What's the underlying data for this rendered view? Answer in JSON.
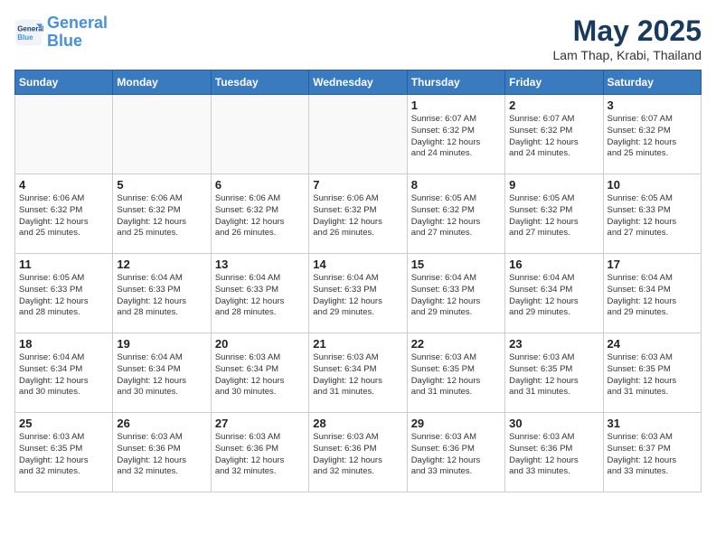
{
  "header": {
    "logo_line1": "General",
    "logo_line2": "Blue",
    "month_title": "May 2025",
    "location": "Lam Thap, Krabi, Thailand"
  },
  "weekdays": [
    "Sunday",
    "Monday",
    "Tuesday",
    "Wednesday",
    "Thursday",
    "Friday",
    "Saturday"
  ],
  "weeks": [
    [
      {
        "day": "",
        "info": ""
      },
      {
        "day": "",
        "info": ""
      },
      {
        "day": "",
        "info": ""
      },
      {
        "day": "",
        "info": ""
      },
      {
        "day": "1",
        "info": "Sunrise: 6:07 AM\nSunset: 6:32 PM\nDaylight: 12 hours\nand 24 minutes."
      },
      {
        "day": "2",
        "info": "Sunrise: 6:07 AM\nSunset: 6:32 PM\nDaylight: 12 hours\nand 24 minutes."
      },
      {
        "day": "3",
        "info": "Sunrise: 6:07 AM\nSunset: 6:32 PM\nDaylight: 12 hours\nand 25 minutes."
      }
    ],
    [
      {
        "day": "4",
        "info": "Sunrise: 6:06 AM\nSunset: 6:32 PM\nDaylight: 12 hours\nand 25 minutes."
      },
      {
        "day": "5",
        "info": "Sunrise: 6:06 AM\nSunset: 6:32 PM\nDaylight: 12 hours\nand 25 minutes."
      },
      {
        "day": "6",
        "info": "Sunrise: 6:06 AM\nSunset: 6:32 PM\nDaylight: 12 hours\nand 26 minutes."
      },
      {
        "day": "7",
        "info": "Sunrise: 6:06 AM\nSunset: 6:32 PM\nDaylight: 12 hours\nand 26 minutes."
      },
      {
        "day": "8",
        "info": "Sunrise: 6:05 AM\nSunset: 6:32 PM\nDaylight: 12 hours\nand 27 minutes."
      },
      {
        "day": "9",
        "info": "Sunrise: 6:05 AM\nSunset: 6:32 PM\nDaylight: 12 hours\nand 27 minutes."
      },
      {
        "day": "10",
        "info": "Sunrise: 6:05 AM\nSunset: 6:33 PM\nDaylight: 12 hours\nand 27 minutes."
      }
    ],
    [
      {
        "day": "11",
        "info": "Sunrise: 6:05 AM\nSunset: 6:33 PM\nDaylight: 12 hours\nand 28 minutes."
      },
      {
        "day": "12",
        "info": "Sunrise: 6:04 AM\nSunset: 6:33 PM\nDaylight: 12 hours\nand 28 minutes."
      },
      {
        "day": "13",
        "info": "Sunrise: 6:04 AM\nSunset: 6:33 PM\nDaylight: 12 hours\nand 28 minutes."
      },
      {
        "day": "14",
        "info": "Sunrise: 6:04 AM\nSunset: 6:33 PM\nDaylight: 12 hours\nand 29 minutes."
      },
      {
        "day": "15",
        "info": "Sunrise: 6:04 AM\nSunset: 6:33 PM\nDaylight: 12 hours\nand 29 minutes."
      },
      {
        "day": "16",
        "info": "Sunrise: 6:04 AM\nSunset: 6:34 PM\nDaylight: 12 hours\nand 29 minutes."
      },
      {
        "day": "17",
        "info": "Sunrise: 6:04 AM\nSunset: 6:34 PM\nDaylight: 12 hours\nand 29 minutes."
      }
    ],
    [
      {
        "day": "18",
        "info": "Sunrise: 6:04 AM\nSunset: 6:34 PM\nDaylight: 12 hours\nand 30 minutes."
      },
      {
        "day": "19",
        "info": "Sunrise: 6:04 AM\nSunset: 6:34 PM\nDaylight: 12 hours\nand 30 minutes."
      },
      {
        "day": "20",
        "info": "Sunrise: 6:03 AM\nSunset: 6:34 PM\nDaylight: 12 hours\nand 30 minutes."
      },
      {
        "day": "21",
        "info": "Sunrise: 6:03 AM\nSunset: 6:34 PM\nDaylight: 12 hours\nand 31 minutes."
      },
      {
        "day": "22",
        "info": "Sunrise: 6:03 AM\nSunset: 6:35 PM\nDaylight: 12 hours\nand 31 minutes."
      },
      {
        "day": "23",
        "info": "Sunrise: 6:03 AM\nSunset: 6:35 PM\nDaylight: 12 hours\nand 31 minutes."
      },
      {
        "day": "24",
        "info": "Sunrise: 6:03 AM\nSunset: 6:35 PM\nDaylight: 12 hours\nand 31 minutes."
      }
    ],
    [
      {
        "day": "25",
        "info": "Sunrise: 6:03 AM\nSunset: 6:35 PM\nDaylight: 12 hours\nand 32 minutes."
      },
      {
        "day": "26",
        "info": "Sunrise: 6:03 AM\nSunset: 6:36 PM\nDaylight: 12 hours\nand 32 minutes."
      },
      {
        "day": "27",
        "info": "Sunrise: 6:03 AM\nSunset: 6:36 PM\nDaylight: 12 hours\nand 32 minutes."
      },
      {
        "day": "28",
        "info": "Sunrise: 6:03 AM\nSunset: 6:36 PM\nDaylight: 12 hours\nand 32 minutes."
      },
      {
        "day": "29",
        "info": "Sunrise: 6:03 AM\nSunset: 6:36 PM\nDaylight: 12 hours\nand 33 minutes."
      },
      {
        "day": "30",
        "info": "Sunrise: 6:03 AM\nSunset: 6:36 PM\nDaylight: 12 hours\nand 33 minutes."
      },
      {
        "day": "31",
        "info": "Sunrise: 6:03 AM\nSunset: 6:37 PM\nDaylight: 12 hours\nand 33 minutes."
      }
    ]
  ]
}
